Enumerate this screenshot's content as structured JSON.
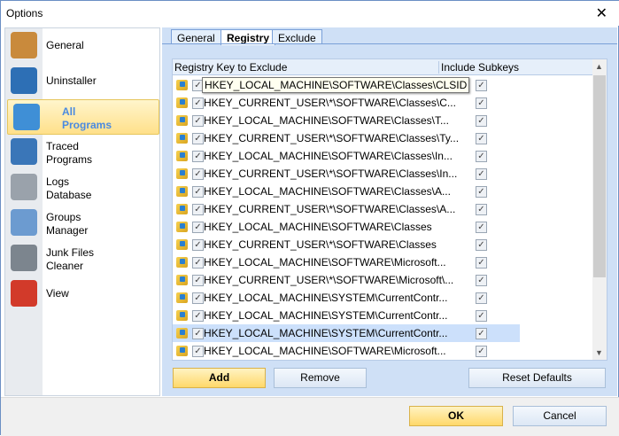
{
  "window": {
    "title": "Options",
    "close": "✕"
  },
  "sidebar": {
    "items": [
      {
        "label": "General",
        "icon": "clipboard-check-icon",
        "color": "#c98a3c"
      },
      {
        "label": "Uninstaller",
        "icon": "uninstaller-r-icon",
        "color": "#2d6fb5"
      },
      {
        "label": "All\nPrograms",
        "icon": "programs-box-icon",
        "color": "#3f8fd6"
      },
      {
        "label": "Traced\nPrograms",
        "icon": "user-box-icon",
        "color": "#3a76b8"
      },
      {
        "label": "Logs\nDatabase",
        "icon": "database-icon",
        "color": "#9aa2ab"
      },
      {
        "label": "Groups\nManager",
        "icon": "groups-icon",
        "color": "#6c9bd0"
      },
      {
        "label": "Junk Files\nCleaner",
        "icon": "vacuum-icon",
        "color": "#7c858e"
      },
      {
        "label": "View",
        "icon": "equalizer-icon",
        "color": "#d23a2a"
      }
    ],
    "selected": 2
  },
  "tabs": [
    "General",
    "Registry",
    "Exclude"
  ],
  "list": {
    "col1": "Registry Key to Exclude",
    "col2": "Include Subkeys",
    "check": "✓",
    "rows": [
      "HKEY_LOCAL_MACHINE\\SOFTWARE\\Classes\\CLSID",
      "HKEY_CURRENT_USER\\*\\SOFTWARE\\Classes\\C...",
      "HKEY_LOCAL_MACHINE\\SOFTWARE\\Classes\\T...",
      "HKEY_CURRENT_USER\\*\\SOFTWARE\\Classes\\Ty...",
      "HKEY_LOCAL_MACHINE\\SOFTWARE\\Classes\\In...",
      "HKEY_CURRENT_USER\\*\\SOFTWARE\\Classes\\In...",
      "HKEY_LOCAL_MACHINE\\SOFTWARE\\Classes\\A...",
      "HKEY_CURRENT_USER\\*\\SOFTWARE\\Classes\\A...",
      "HKEY_LOCAL_MACHINE\\SOFTWARE\\Classes",
      "HKEY_CURRENT_USER\\*\\SOFTWARE\\Classes",
      "HKEY_LOCAL_MACHINE\\SOFTWARE\\Microsoft...",
      "HKEY_CURRENT_USER\\*\\SOFTWARE\\Microsoft\\...",
      "HKEY_LOCAL_MACHINE\\SYSTEM\\CurrentContr...",
      "HKEY_LOCAL_MACHINE\\SYSTEM\\CurrentContr...",
      "HKEY_LOCAL_MACHINE\\SYSTEM\\CurrentContr...",
      "HKEY_LOCAL_MACHINE\\SOFTWARE\\Microsoft..."
    ],
    "selected_row": 14
  },
  "buttons": {
    "add": "Add",
    "remove": "Remove",
    "reset": "Reset Defaults",
    "ok": "OK",
    "cancel": "Cancel"
  }
}
